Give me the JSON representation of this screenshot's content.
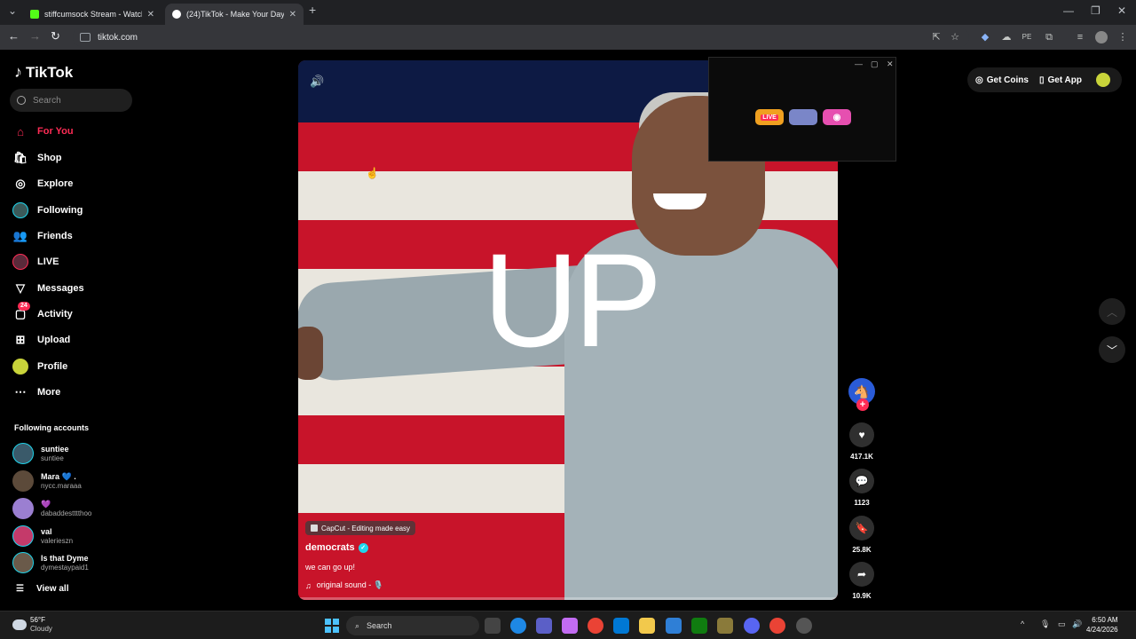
{
  "browser": {
    "tabs": [
      {
        "title": "stiffcumsock Stream - Watch Li",
        "active": false,
        "favicon_color": "#53fc18"
      },
      {
        "title": "(24)TikTok - Make Your Day",
        "active": true,
        "favicon_color": "#ffffff"
      }
    ],
    "url": "tiktok.com"
  },
  "sidebar": {
    "brand": "TikTok",
    "search_placeholder": "Search",
    "nav": [
      {
        "label": "For You",
        "icon": "home-icon",
        "active": true
      },
      {
        "label": "Shop",
        "icon": "shop-bag-icon"
      },
      {
        "label": "Explore",
        "icon": "compass-icon"
      },
      {
        "label": "Following",
        "icon": "following-avatar-icon"
      },
      {
        "label": "Friends",
        "icon": "friends-icon"
      },
      {
        "label": "LIVE",
        "icon": "live-icon"
      },
      {
        "label": "Messages",
        "icon": "paper-plane-icon"
      },
      {
        "label": "Activity",
        "icon": "activity-icon",
        "badge": "24"
      },
      {
        "label": "Upload",
        "icon": "plus-square-icon"
      },
      {
        "label": "Profile",
        "icon": "profile-avatar-icon"
      },
      {
        "label": "More",
        "icon": "more-dots-icon"
      }
    ],
    "following_title": "Following accounts",
    "following": [
      {
        "name": "suntiee",
        "username": "suntiee",
        "avatar_color": "#3a5a6a"
      },
      {
        "name": "Mara 💙 .",
        "username": "nycc.maraaa",
        "avatar_color": "#5c4a3a"
      },
      {
        "name": "💜",
        "username": "dabaddestttthoo",
        "avatar_color": "#9b7fd1"
      },
      {
        "name": "val",
        "username": "valerieszn",
        "avatar_color": "#c43a6a"
      },
      {
        "name": "Is that Dyme",
        "username": "dymestaypaid1",
        "avatar_color": "#6a5a4a"
      }
    ],
    "view_all": "View all"
  },
  "video": {
    "overlay_text": "UP",
    "effect_label": "CapCut - Editing made easy",
    "author": "democrats",
    "caption": "we can go up!",
    "sound": "original sound - 🎙️",
    "progress": 0.0
  },
  "actions": {
    "likes": "417.1K",
    "comments": "1123",
    "saves": "25.8K",
    "shares": "10.9K"
  },
  "mini_player": {
    "chips": [
      "LIVE",
      "",
      ""
    ]
  },
  "header": {
    "get_coins": "Get Coins",
    "get_app": "Get App"
  },
  "taskbar": {
    "temp": "56°F",
    "weather": "Cloudy",
    "search": "Search",
    "time": "6:50 AM",
    "date": "4/24/2026"
  }
}
